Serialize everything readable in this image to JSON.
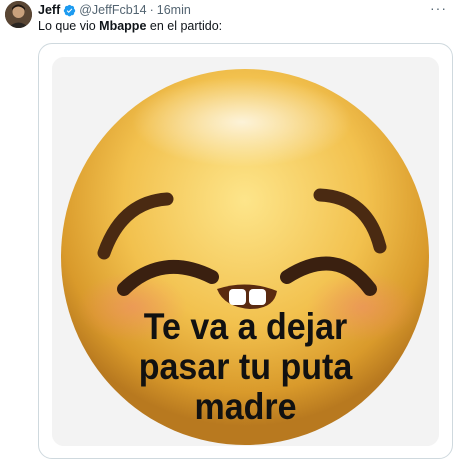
{
  "tweet": {
    "author_name": "Jeff",
    "handle": "@JeffFcb14",
    "separator": "·",
    "time": "16min",
    "more_label": "···",
    "text_before": "Lo que vio ",
    "text_bold": "Mbappe",
    "text_after": " en el partido:",
    "accent_color": "#1d9bf0"
  },
  "media": {
    "caption_lines": [
      "Te va a dejar",
      "pasar tu puta",
      "madre"
    ]
  }
}
